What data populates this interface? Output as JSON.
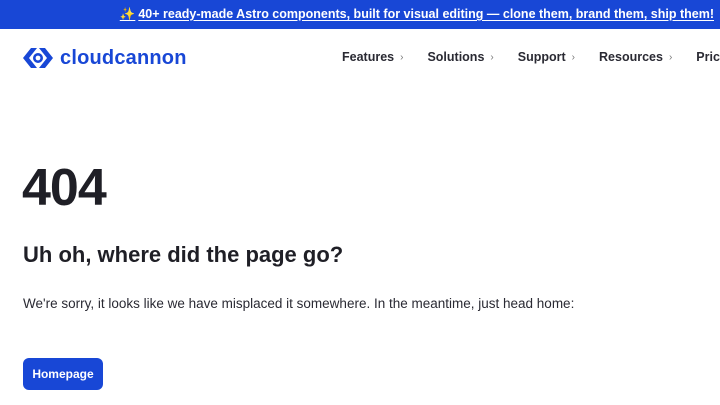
{
  "announcement": {
    "sparkle": "✨",
    "text": "40+ ready-made Astro components, built for visual editing — clone them, brand them, ship them!"
  },
  "brand": {
    "name": "cloudcannon",
    "accent": "#1847d6"
  },
  "nav": {
    "items": [
      {
        "label": "Features",
        "chevron": "›"
      },
      {
        "label": "Solutions",
        "chevron": "›"
      },
      {
        "label": "Support",
        "chevron": "›"
      },
      {
        "label": "Resources",
        "chevron": "›"
      },
      {
        "label": "Pricing"
      }
    ]
  },
  "error": {
    "code": "404",
    "headline": "Uh oh, where did the page go?",
    "message": "We're sorry, it looks like we have misplaced it somewhere. In the meantime, just head home:",
    "button_label": "Homepage"
  }
}
